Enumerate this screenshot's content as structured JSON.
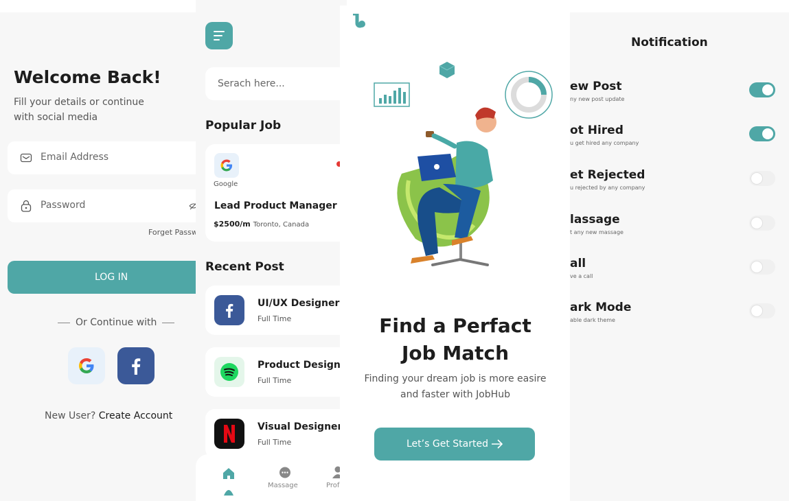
{
  "colors": {
    "accent": "#4fa7a6",
    "facebook": "#3b5998"
  },
  "login": {
    "title": "Welcome Back!",
    "subtitle": "Fill your details or continue with social media",
    "email_placeholder": "Email Address",
    "password_placeholder": "Password",
    "forget_password": "Forget Passw",
    "login_button": "LOG IN",
    "or_continue": "Or Continue with",
    "new_user": "New User?",
    "create_account": "Create Account",
    "icons": [
      "mail-icon",
      "lock-icon",
      "eye-off-icon",
      "google-icon",
      "facebook-icon"
    ]
  },
  "home": {
    "search_placeholder": "Serach here...",
    "popular_title": "Popular Job",
    "popular_job": {
      "company": "Google",
      "role": "Lead Product Manager",
      "salary": "$2500/m",
      "location": "Toronto, Canada"
    },
    "recent_title": "Recent Post",
    "recent_posts": [
      {
        "title": "UI/UX Designer",
        "type": "Full Time",
        "logo": "facebook-icon"
      },
      {
        "title": "Product Designe",
        "type": "Full Time",
        "logo": "spotify-icon"
      },
      {
        "title": "Visual Designer",
        "type": "Full Time",
        "logo": "netflix-icon"
      }
    ],
    "nav": {
      "message": "Massage",
      "profile": "Prof"
    }
  },
  "onboarding": {
    "title_line1": "Find a Perfact",
    "title_line2": "Job Match",
    "desc_line1": "Finding your dream job is more easire",
    "desc_line2": "and faster with JobHub",
    "button": "Let’s Get Started"
  },
  "notifications": {
    "title": "Notification",
    "items": [
      {
        "label": "ew Post",
        "sub": "ny new post update",
        "enabled": true
      },
      {
        "label": "ot Hired",
        "sub": "u get hired any company",
        "enabled": true
      },
      {
        "label": "et Rejected",
        "sub": "u rejected by any company",
        "enabled": false
      },
      {
        "label": "lassage",
        "sub": "t any new massage",
        "enabled": false
      },
      {
        "label": "all",
        "sub": "ve a call",
        "enabled": false
      },
      {
        "label": "ark Mode",
        "sub": "able dark theme",
        "enabled": false
      }
    ]
  }
}
